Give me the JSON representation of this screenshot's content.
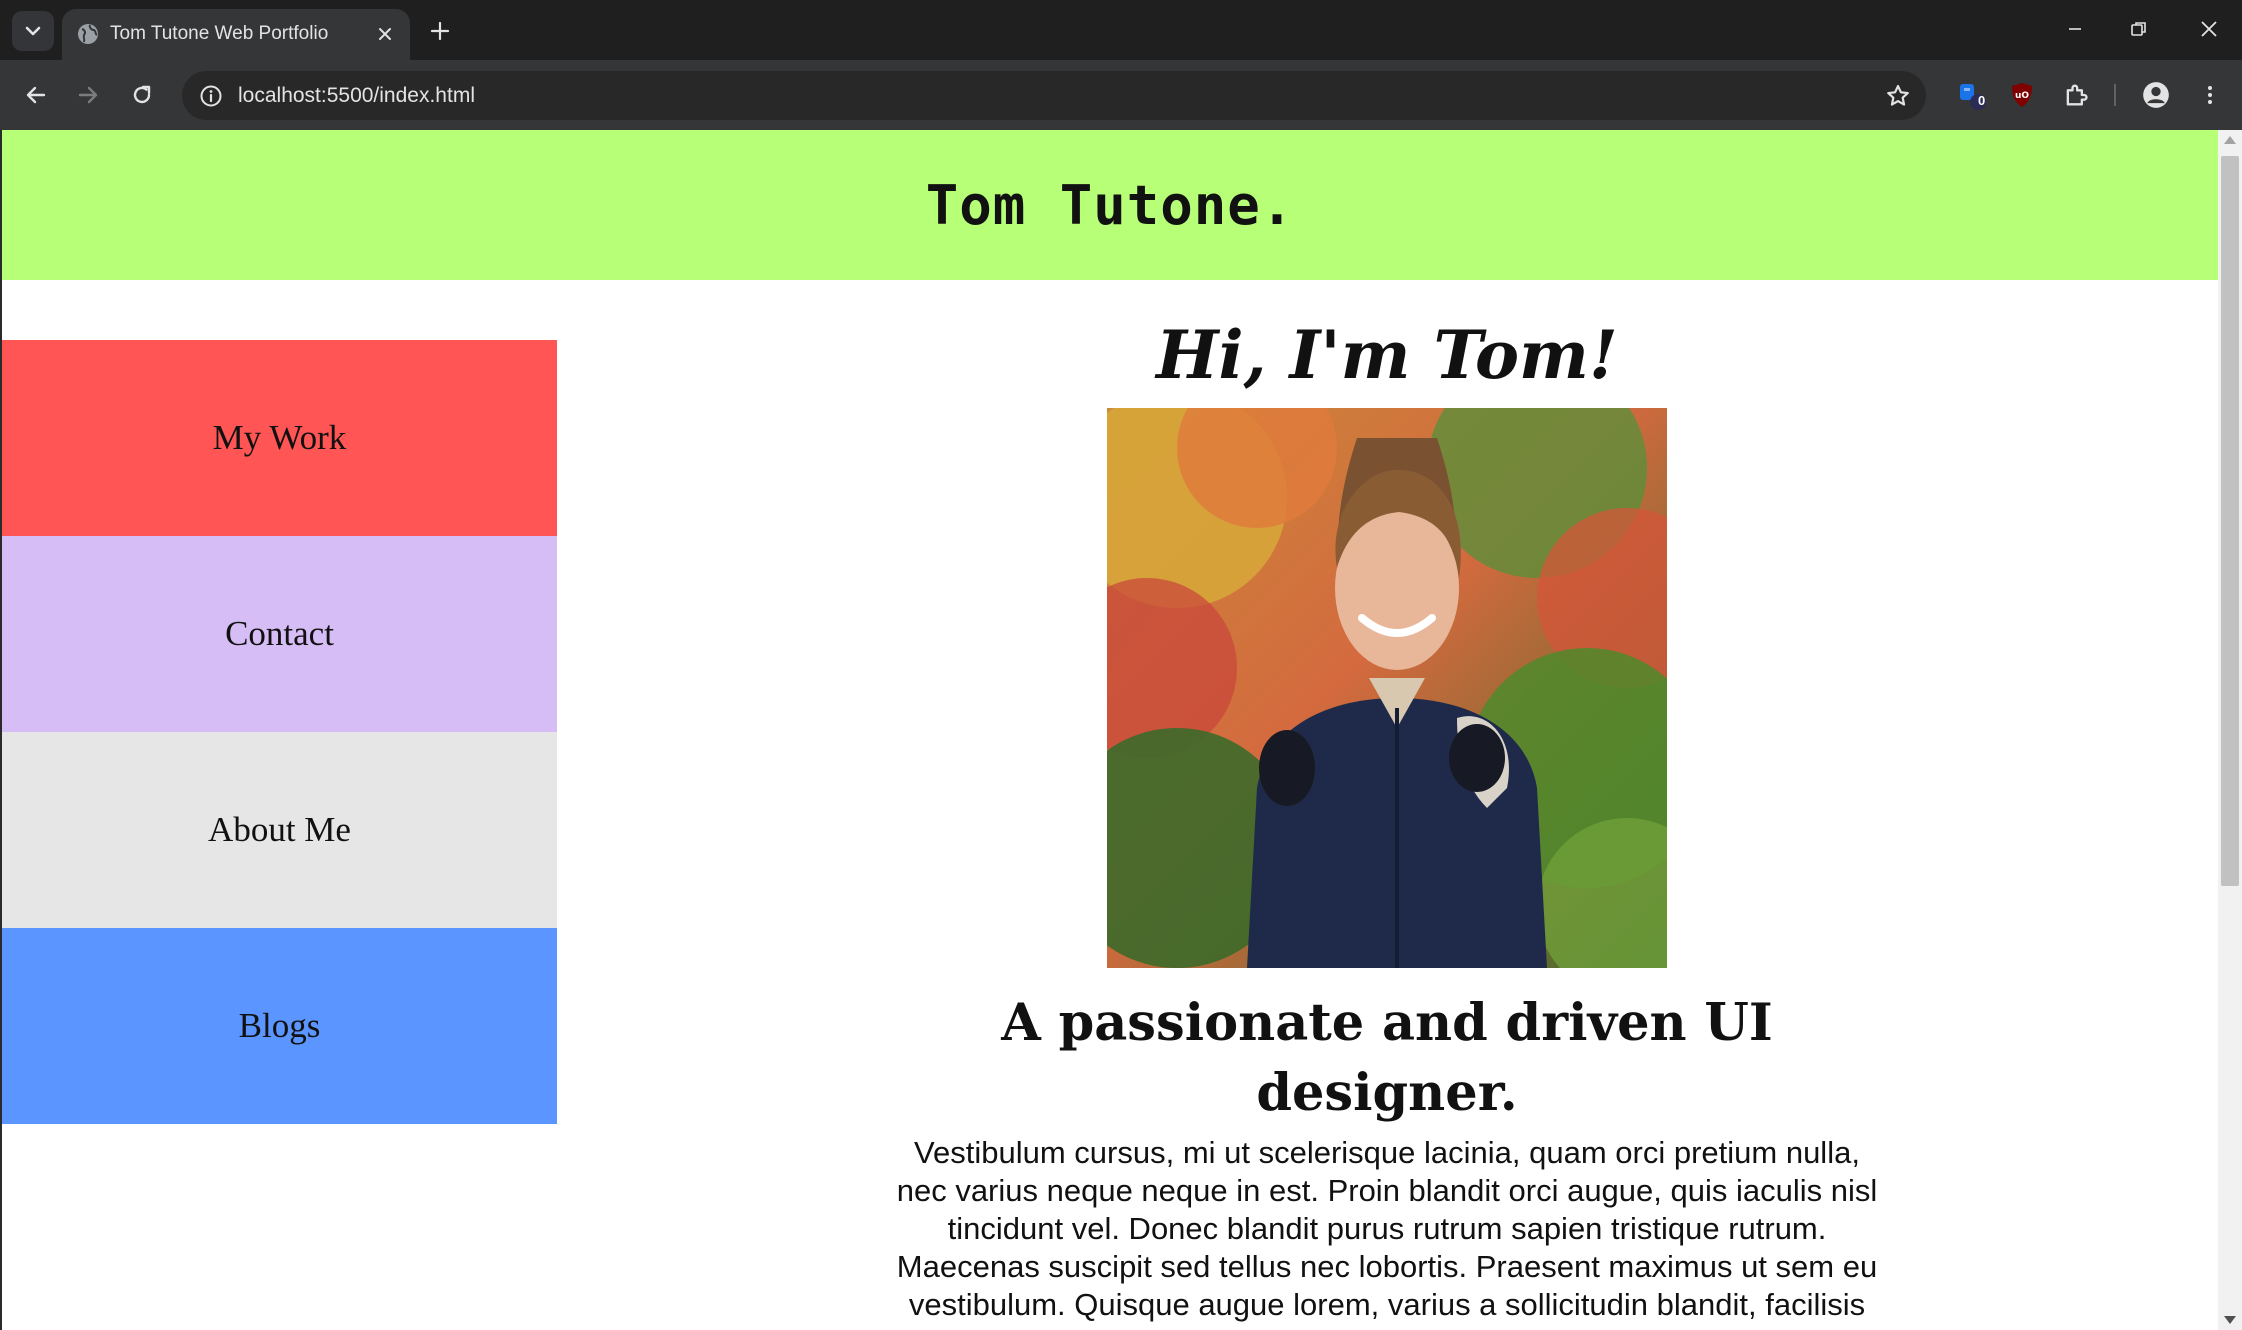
{
  "browser": {
    "tab": {
      "title": "Tom Tutone Web Portfolio"
    },
    "address": {
      "url": "localhost:5500/index.html"
    },
    "extensions": {
      "badge_count": "0"
    }
  },
  "site": {
    "logo": "Tom Tutone.",
    "nav": [
      {
        "label": "My Work",
        "color": "#ff5555"
      },
      {
        "label": "Contact",
        "color": "#d7bdf5"
      },
      {
        "label": "About Me",
        "color": "#e6e6e6"
      },
      {
        "label": "Blogs",
        "color": "#5b95ff"
      }
    ],
    "header_color": "#b8ff78",
    "hero_title": "Hi, I'm Tom!",
    "tagline": "A passionate and driven UI designer.",
    "bio": "Vestibulum cursus, mi ut scelerisque lacinia, quam orci pretium nulla, nec varius neque neque in est. Proin blandit orci augue, quis iaculis nisl tincidunt vel. Donec blandit purus rutrum sapien tristique rutrum. Maecenas suscipit sed tellus nec lobortis. Praesent maximus ut sem eu vestibulum. Quisque augue lorem, varius a sollicitudin blandit, facilisis sed erat. Nullam fermentum, velit vitae malesuada maximus, justo"
  }
}
